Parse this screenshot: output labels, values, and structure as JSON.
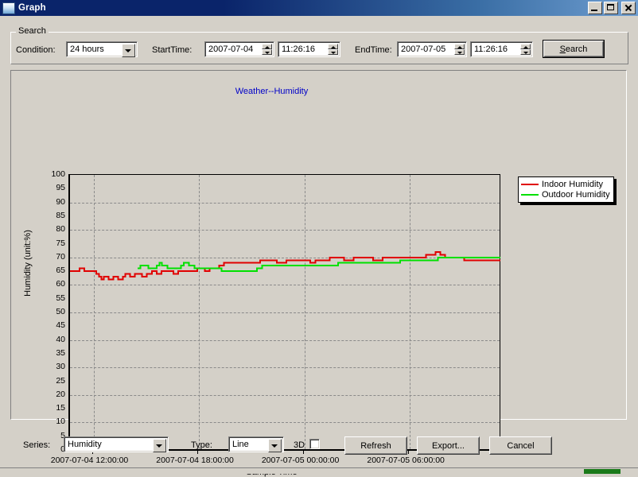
{
  "window": {
    "title": "Graph",
    "icon": "window-icon",
    "buttons": {
      "minimize": "_",
      "maximize": "□",
      "close": "×"
    }
  },
  "search": {
    "group_label": "Search",
    "condition_label": "Condition:",
    "condition_value": "24 hours",
    "condition_options": [
      "24 hours"
    ],
    "start_time_label": "StartTime:",
    "start_date_value": "2007-07-04",
    "start_clock_value": "11:26:16",
    "end_time_label": "EndTime:",
    "end_date_value": "2007-07-05",
    "end_clock_value": "11:26:16",
    "search_button": "Search",
    "search_button_accel": "S"
  },
  "footer": {
    "series_label": "Series:",
    "series_value": "Humidity",
    "series_options": [
      "Humidity"
    ],
    "type_label": "Type:",
    "type_value": "Line",
    "type_options": [
      "Line"
    ],
    "threed_label": "3D",
    "threed_checked": false,
    "refresh_button": "Refresh",
    "export_button": "Export...",
    "cancel_button": "Cancel"
  },
  "colors": {
    "title_bar_start": "#0a246a",
    "title_bar_end": "#6f9ed0",
    "face": "#d4d0c8",
    "chart_title": "#0000c8",
    "indoor": "#e00000",
    "outdoor": "#00e000",
    "grid": "#8a8a8a"
  },
  "chart_data": {
    "type": "line",
    "title": "Weather--Humidity",
    "xlabel": "Sample Time",
    "ylabel": "Humidity (unit:%)",
    "grid": true,
    "legend_position": "top-right",
    "ylim": [
      0,
      100
    ],
    "yticks": [
      0,
      5,
      10,
      15,
      20,
      25,
      30,
      35,
      40,
      45,
      50,
      55,
      60,
      65,
      70,
      75,
      80,
      85,
      90,
      95,
      100
    ],
    "xticks": [
      "2007-07-04 12:00:00",
      "2007-07-04 18:00:00",
      "2007-07-05 00:00:00",
      "2007-07-05 06:00:00"
    ],
    "xtick_fractions": [
      0.055,
      0.3,
      0.545,
      0.79
    ],
    "xlim": [
      "2007-07-04 11:26:16",
      "2007-07-05 11:26:16"
    ],
    "series": [
      {
        "name": "Indoor Humidity",
        "color": "#e00000",
        "values": [
          65,
          65,
          65,
          65,
          66,
          66,
          65,
          65,
          65,
          65,
          65,
          64,
          63,
          62,
          63,
          63,
          62,
          62,
          63,
          63,
          62,
          62,
          63,
          64,
          64,
          63,
          63,
          64,
          64,
          64,
          63,
          63,
          64,
          64,
          65,
          65,
          64,
          64,
          65,
          65,
          65,
          65,
          65,
          64,
          64,
          65,
          65,
          65,
          65,
          65,
          65,
          65,
          65,
          66,
          66,
          66,
          65,
          65,
          66,
          66,
          66,
          66,
          67,
          67,
          68,
          68,
          68,
          68,
          68,
          68,
          68,
          68,
          68,
          68,
          68,
          68,
          68,
          68,
          68,
          69,
          69,
          69,
          69,
          69,
          69,
          69,
          68,
          68,
          68,
          68,
          69,
          69,
          69,
          69,
          69,
          69,
          69,
          69,
          69,
          69,
          68,
          68,
          69,
          69,
          69,
          69,
          69,
          69,
          70,
          70,
          70,
          70,
          70,
          70,
          69,
          69,
          69,
          69,
          70,
          70,
          70,
          70,
          70,
          70,
          70,
          70,
          69,
          69,
          69,
          69,
          70,
          70,
          70,
          70,
          70,
          70,
          70,
          70,
          70,
          70,
          70,
          70,
          70,
          70,
          70,
          70,
          70,
          70,
          71,
          71,
          71,
          71,
          72,
          72,
          71,
          71,
          70,
          70,
          70,
          70,
          70,
          70,
          70,
          70,
          69,
          69,
          69,
          69,
          69,
          69,
          69,
          69,
          69,
          69,
          69,
          69,
          69,
          69,
          69,
          69
        ]
      },
      {
        "name": "Outdoor Humidity",
        "color": "#00e000",
        "values": [
          null,
          null,
          null,
          null,
          null,
          null,
          null,
          null,
          null,
          null,
          null,
          null,
          null,
          null,
          null,
          null,
          null,
          null,
          null,
          null,
          null,
          null,
          null,
          null,
          null,
          66,
          67,
          67,
          67,
          66,
          66,
          66,
          67,
          68,
          67,
          67,
          66,
          66,
          66,
          66,
          66,
          67,
          68,
          68,
          67,
          67,
          66,
          66,
          66,
          66,
          66,
          66,
          66,
          66,
          66,
          66,
          65,
          65,
          65,
          65,
          65,
          65,
          65,
          65,
          65,
          65,
          65,
          65,
          65,
          66,
          66,
          67,
          67,
          67,
          67,
          67,
          67,
          67,
          67,
          67,
          67,
          67,
          67,
          67,
          67,
          67,
          67,
          67,
          67,
          67,
          67,
          67,
          67,
          67,
          67,
          67,
          67,
          67,
          67,
          68,
          68,
          68,
          68,
          68,
          68,
          68,
          68,
          68,
          68,
          68,
          68,
          68,
          68,
          68,
          68,
          68,
          68,
          68,
          68,
          68,
          68,
          68,
          69,
          69,
          69,
          69,
          69,
          69,
          69,
          69,
          69,
          69,
          69,
          69,
          69,
          69,
          70,
          70,
          70,
          70,
          70,
          70,
          70,
          70,
          70,
          70,
          70,
          70,
          70,
          70,
          70,
          70,
          70,
          70,
          70,
          70,
          70,
          70,
          70,
          70
        ]
      }
    ]
  }
}
